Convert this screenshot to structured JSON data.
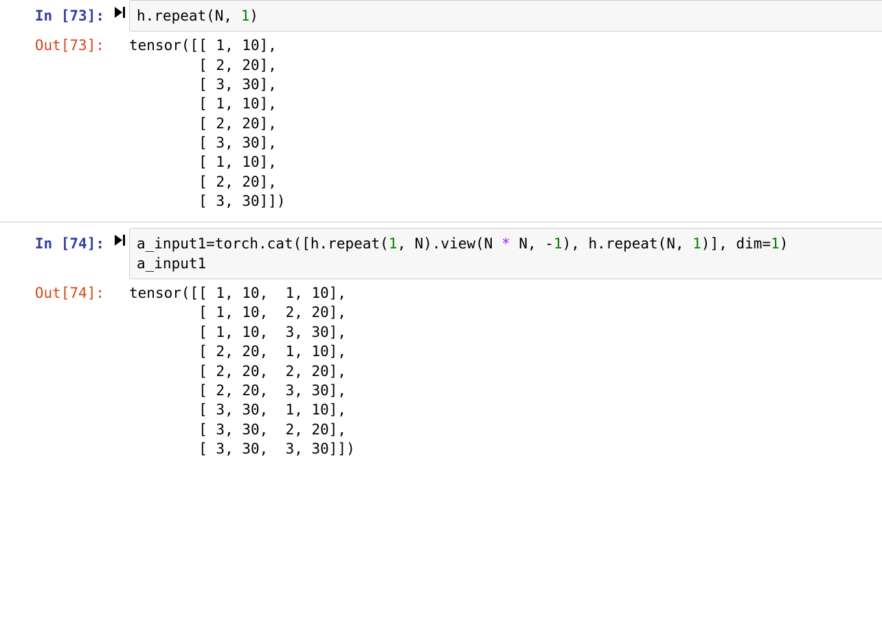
{
  "cells": [
    {
      "in_prompt": "In [73]:",
      "out_prompt": "Out[73]:",
      "code_tokens": [
        {
          "t": "h.repeat(N, ",
          "c": ""
        },
        {
          "t": "1",
          "c": "num"
        },
        {
          "t": ")",
          "c": ""
        }
      ],
      "output_lines": [
        "tensor([[ 1, 10],",
        "        [ 2, 20],",
        "        [ 3, 30],",
        "        [ 1, 10],",
        "        [ 2, 20],",
        "        [ 3, 30],",
        "        [ 1, 10],",
        "        [ 2, 20],",
        "        [ 3, 30]])"
      ]
    },
    {
      "in_prompt": "In [74]:",
      "out_prompt": "Out[74]:",
      "code_tokens": [
        {
          "t": "a_input1",
          "c": ""
        },
        {
          "t": "=",
          "c": ""
        },
        {
          "t": "torch.cat([h.repeat(",
          "c": ""
        },
        {
          "t": "1",
          "c": "num"
        },
        {
          "t": ", N).view(N ",
          "c": ""
        },
        {
          "t": "*",
          "c": "op"
        },
        {
          "t": " N, ",
          "c": ""
        },
        {
          "t": "-",
          "c": ""
        },
        {
          "t": "1",
          "c": "num"
        },
        {
          "t": "), h.repeat(N, ",
          "c": ""
        },
        {
          "t": "1",
          "c": "num"
        },
        {
          "t": ")], dim",
          "c": ""
        },
        {
          "t": "=",
          "c": ""
        },
        {
          "t": "1",
          "c": "num"
        },
        {
          "t": ")\n",
          "c": ""
        },
        {
          "t": "a_input1",
          "c": ""
        }
      ],
      "output_lines": [
        "tensor([[ 1, 10,  1, 10],",
        "        [ 1, 10,  2, 20],",
        "        [ 1, 10,  3, 30],",
        "        [ 2, 20,  1, 10],",
        "        [ 2, 20,  2, 20],",
        "        [ 2, 20,  3, 30],",
        "        [ 3, 30,  1, 10],",
        "        [ 3, 30,  2, 20],",
        "        [ 3, 30,  3, 30]])"
      ]
    }
  ]
}
